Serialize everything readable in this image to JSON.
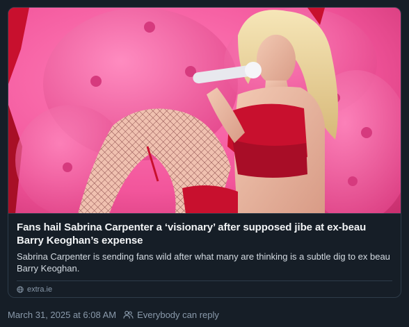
{
  "link_card": {
    "headline": "Fans hail Sabrina Carpenter a ‘visionary’ after supposed jibe at ex-beau Barry Keoghan’s expense",
    "description": "Sabrina Carpenter is sending fans wild after what many are thinking is a subtle dig to ex beau Barry Keoghan.",
    "domain": "extra.ie",
    "domain_icon": "globe-icon"
  },
  "post_meta": {
    "timestamp": "March 31, 2025 at 6:08 AM",
    "reply_setting": "Everybody can reply",
    "reply_icon": "people-icon"
  },
  "colors": {
    "background": "#161e27",
    "border": "#2e3c4a",
    "muted_text": "#8a9aab",
    "image_pink": "#f2559b",
    "image_red": "#c8102e"
  }
}
